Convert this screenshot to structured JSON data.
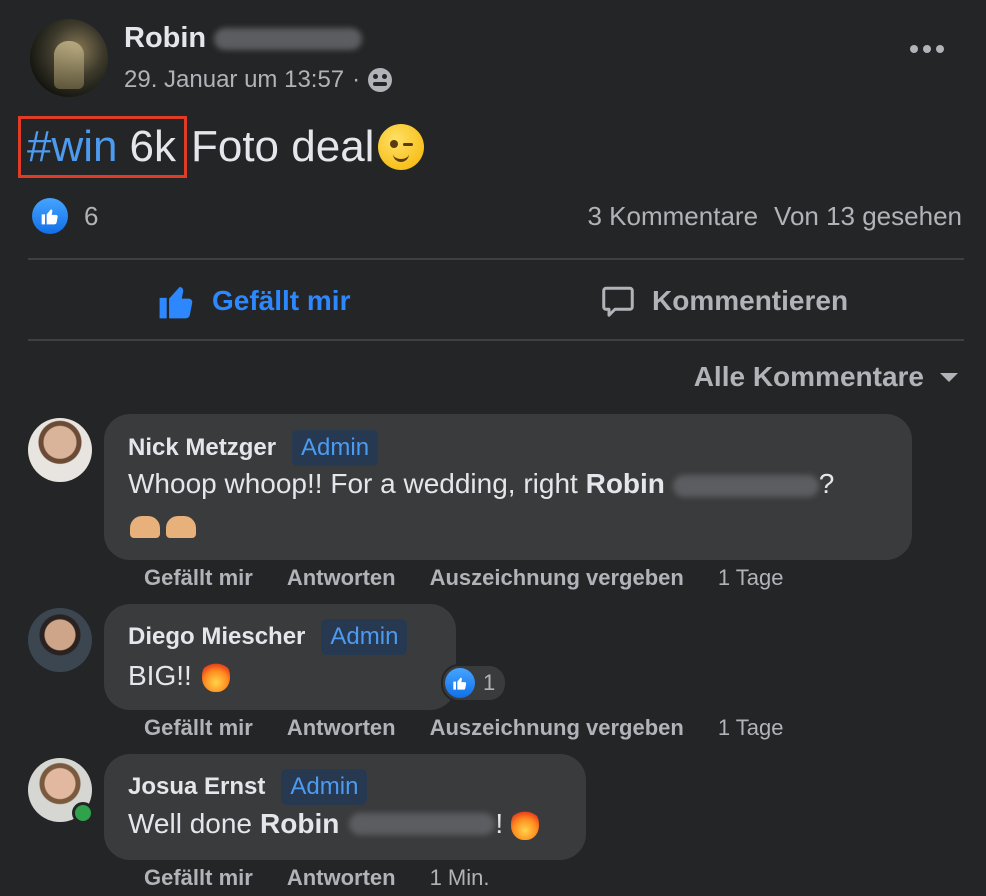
{
  "post": {
    "author_first": "Robin",
    "timestamp": "29. Januar um 13:57",
    "audience_separator": "·",
    "audience_icon": "friends-icon",
    "hashtag": "#win",
    "highlight_value": "6k",
    "text_rest": "Foto deal",
    "emoji": "winking-face",
    "highlight_color": "#e03b24"
  },
  "stats": {
    "reaction_count": "6",
    "comments": "3 Kommentare",
    "seen": "Von 13 gesehen"
  },
  "actions": {
    "like_label": "Gefällt mir",
    "comment_label": "Kommentieren"
  },
  "sort": {
    "label": "Alle Kommentare"
  },
  "comments": [
    {
      "name": "Nick Metzger",
      "badge": "Admin",
      "text_before": "Whoop whoop!! For a wedding, right ",
      "mention": "Robin",
      "text_after": "?",
      "emoji": "raising-hands",
      "like": "Gefällt mir",
      "reply": "Antworten",
      "award": "Auszeichnung vergeben",
      "time": "1 Tage"
    },
    {
      "name": "Diego Miescher",
      "badge": "Admin",
      "text": "BIG!!",
      "emoji": "fire",
      "reactions": "1",
      "like": "Gefällt mir",
      "reply": "Antworten",
      "award": "Auszeichnung vergeben",
      "time": "1 Tage"
    },
    {
      "name": "Josua Ernst",
      "badge": "Admin",
      "text_before": "Well done ",
      "mention": "Robin",
      "text_after": "!",
      "emoji": "fire",
      "like": "Gefällt mir",
      "reply": "Antworten",
      "time": "1 Min."
    }
  ],
  "colors": {
    "background": "#242526",
    "bubble": "#3a3b3c",
    "accent": "#2d88ff",
    "link": "#4d9bf0",
    "online": "#31a24c"
  }
}
